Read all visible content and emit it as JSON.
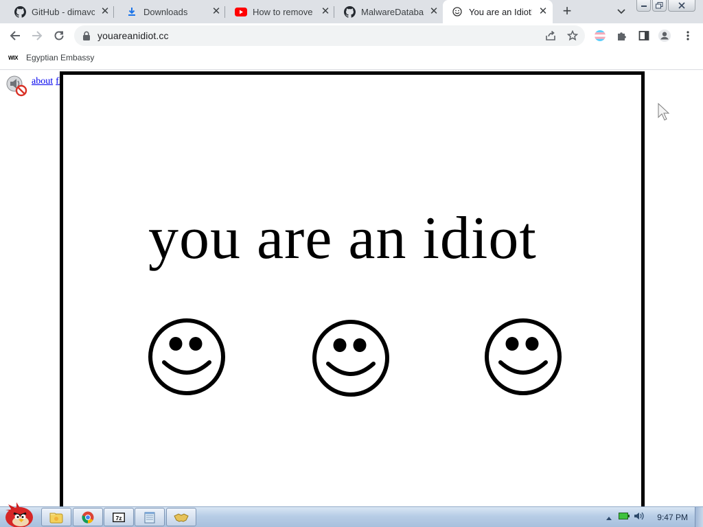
{
  "browser": {
    "tabs": [
      {
        "title": "GitHub - dimavc",
        "icon": "github-icon"
      },
      {
        "title": "Downloads",
        "icon": "download-icon"
      },
      {
        "title": "How to remove",
        "icon": "youtube-icon"
      },
      {
        "title": "MalwareDataba",
        "icon": "github-icon"
      },
      {
        "title": "You are an Idiot!",
        "icon": "smiley-icon",
        "active": true
      }
    ],
    "new_tab_label": "+",
    "url": "youareanidiot.cc",
    "bookmarks": [
      {
        "label": "Egyptian Embassy",
        "icon_text": "WIX"
      }
    ]
  },
  "page": {
    "links": [
      {
        "label": "about"
      },
      {
        "label": "flash"
      }
    ],
    "headline": "you are an idiot",
    "smiley_glyph": "☺",
    "smiley_count": 3
  },
  "taskbar": {
    "pinned": [
      "explorer",
      "chrome",
      "7zip",
      "notepad",
      "handshake"
    ],
    "clock": "9:47 PM"
  },
  "colors": {
    "tabstrip_bg": "#dee1e6",
    "link": "#0000ee",
    "frame_border": "#000000"
  }
}
